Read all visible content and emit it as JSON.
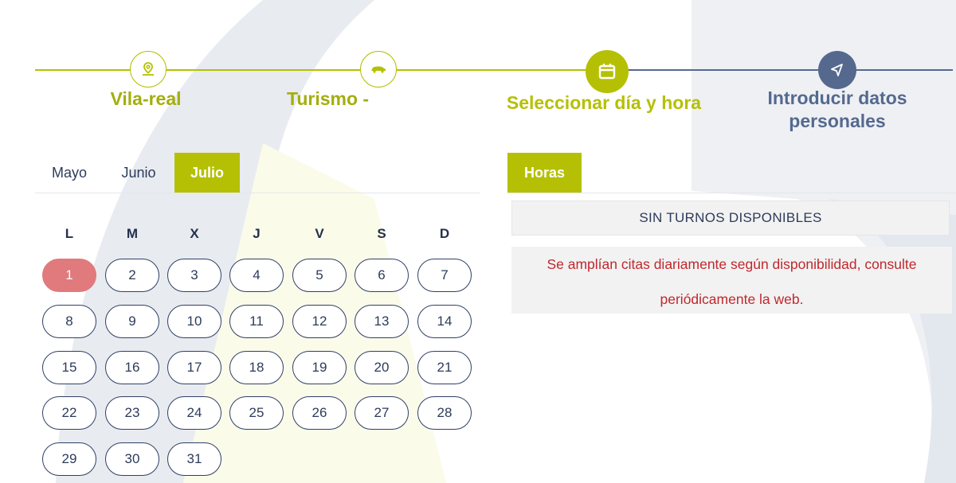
{
  "stepper": {
    "steps": [
      {
        "label": "Vila-real",
        "icon": "map-pin-icon",
        "state": "done"
      },
      {
        "label": "Turismo -",
        "icon": "car-icon",
        "state": "done"
      },
      {
        "label": "Seleccionar día y hora",
        "icon": "calendar-icon",
        "state": "active"
      },
      {
        "label": "Introducir datos personales",
        "icon": "send-icon",
        "state": "pending"
      }
    ]
  },
  "calendar": {
    "months": [
      "Mayo",
      "Junio",
      "Julio"
    ],
    "active_month": "Julio",
    "weekdays": [
      "L",
      "M",
      "X",
      "J",
      "V",
      "S",
      "D"
    ],
    "days": [
      "1",
      "2",
      "3",
      "4",
      "5",
      "6",
      "7",
      "8",
      "9",
      "10",
      "11",
      "12",
      "13",
      "14",
      "15",
      "16",
      "17",
      "18",
      "19",
      "20",
      "21",
      "22",
      "23",
      "24",
      "25",
      "26",
      "27",
      "28",
      "29",
      "30",
      "31"
    ],
    "selected_day": "1"
  },
  "hours": {
    "tab_label": "Horas",
    "no_slots_text": "SIN TURNOS DISPONIBLES",
    "notice_text": "Se amplían citas diariamente según disponibilidad, consulte periódicamente la web."
  },
  "colors": {
    "accent": "#b5c004",
    "navy": "#55698f",
    "selected_day": "#e07a7d",
    "notice_red": "#c0282d"
  }
}
